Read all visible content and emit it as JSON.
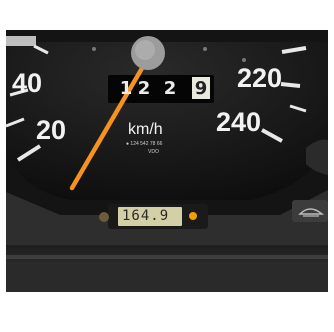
{
  "speedometer": {
    "scale_labels": [
      "40",
      "20",
      "220",
      "240"
    ],
    "unit_label": "km/h",
    "part_number": "● 124 542 78 66",
    "maker": "VDO",
    "odometer_digits": [
      "1",
      "2",
      "2",
      "9"
    ],
    "needle_reading": 10
  },
  "trip_display": {
    "value": "164.9"
  },
  "colors": {
    "needle": "#f7921e",
    "trip_lcd": "#d3cfa7",
    "dial_face": "#151515",
    "scale_text": "#f2f2f2"
  },
  "icons": [
    "washer-fluid-warning-icon",
    "indicator-lamp-icon"
  ]
}
